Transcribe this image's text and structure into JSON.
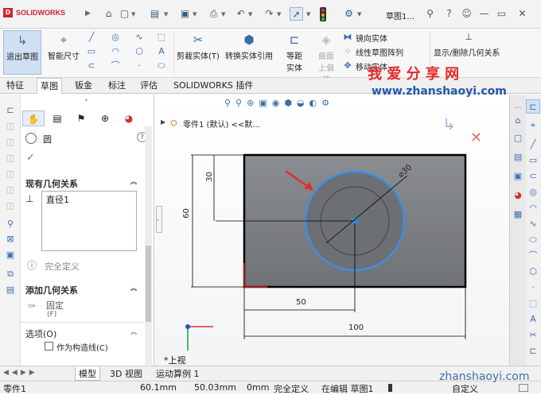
{
  "app": {
    "name": "SOLIDWORKS",
    "doc_title": "草图1...",
    "brand_color": "#d2222d"
  },
  "title_bar": {
    "icons": [
      "home-icon",
      "new-icon",
      "open-icon",
      "save-icon",
      "print-icon",
      "undo-icon",
      "redo-icon",
      "select-icon",
      "traffic-light-icon",
      "options-icon"
    ]
  },
  "command_bar": {
    "exit_sketch": "退出草图",
    "smart_dim": "智能尺寸",
    "trim": "剪裁实体(T)",
    "convert": "转换实体引用",
    "offset": "等距实体",
    "offset_surface": "曲面上偏移",
    "mirror": "镜向实体",
    "linear_pattern": "线性草图阵列",
    "move": "移动实体",
    "display_delete": "显示/删除几何关系"
  },
  "tabs": [
    "特征",
    "草图",
    "钣金",
    "标注",
    "评估",
    "SOLIDWORKS 插件"
  ],
  "active_tab": "草图",
  "property_manager": {
    "title": "圆",
    "existing_relations": "现有几何关系",
    "relation_item": "直径1",
    "status": "完全定义",
    "add_relations": "添加几何关系",
    "fixed": "固定",
    "fixed_key": "(F)",
    "options": "选项(O)",
    "construction": "作为构造线(C)"
  },
  "tree": {
    "part": "零件1 (默认) <<默..."
  },
  "view_label": "*上视",
  "dimensions": {
    "height": "60",
    "top_offset": "30",
    "x_offset": "50",
    "width": "100",
    "diameter": "⌀30"
  },
  "bottom_tabs": [
    "模型",
    "3D 视图",
    "运动算例 1"
  ],
  "status_bar": {
    "name": "零件1",
    "x": "60.1mm",
    "y": "50.03mm",
    "z": "0mm",
    "state": "完全定义",
    "editing": "在编辑 草图1",
    "units": "自定义"
  },
  "watermark": {
    "cn": "我 爱 分 享 网",
    "url": "www.zhanshaoyi.com",
    "url2": "zhanshaoyi.com"
  }
}
